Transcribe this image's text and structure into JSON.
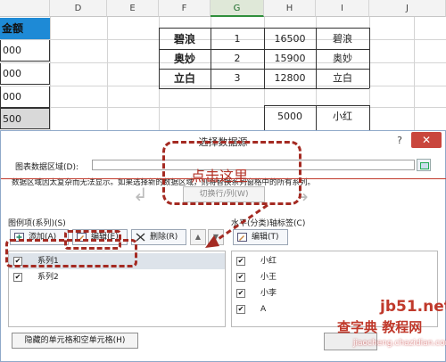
{
  "sheet": {
    "columns": [
      "D",
      "E",
      "F",
      "G",
      "H",
      "I",
      "J"
    ],
    "selected_column": "G",
    "amount_header": "金额",
    "left_values": [
      "000",
      "000",
      "000",
      "500"
    ],
    "table_rows": [
      {
        "name": "碧浪",
        "rank": "1",
        "amount": "16500",
        "person": "碧浪"
      },
      {
        "name": "奥妙",
        "rank": "2",
        "amount": "15900",
        "person": "奥妙"
      },
      {
        "name": "立白",
        "rank": "3",
        "amount": "12800",
        "person": "立白"
      }
    ],
    "extra_row": {
      "amount": "5000",
      "person": "小红"
    }
  },
  "dialog": {
    "title": "选择数据源",
    "help": "?",
    "close": "✕",
    "range_label": "图表数据区域(D):",
    "warning": "数据区域因太复杂而无法显示。如果选择新的数据区域，则将替换系列窗格中的所有系列。",
    "switch_label": "切换行/列(W)",
    "legend_label": "图例项(系列)(S)",
    "legend_buttons": {
      "add": "添加(A)",
      "edit": "编辑(E)",
      "delete": "删除(R)"
    },
    "series": [
      {
        "label": "系列1",
        "checked": true
      },
      {
        "label": "系列2",
        "checked": true
      }
    ],
    "axis_label": "水平(分类)轴标签(C)",
    "axis_edit": "编辑(T)",
    "categories": [
      {
        "label": "小红",
        "checked": true
      },
      {
        "label": "小王",
        "checked": true
      },
      {
        "label": "小李",
        "checked": true
      },
      {
        "label": "A",
        "checked": true
      }
    ],
    "hidden_cells_button": "隐藏的单元格和空单元格(H)"
  },
  "annotation": {
    "callout": "点击这里"
  },
  "watermarks": {
    "site": "jb51.net",
    "brand": "查字典 教程网",
    "subsite": "jiaocheng.chazidian.com"
  },
  "colors": {
    "header_blue": "#1e8ad6",
    "annotation_red": "#a42a22",
    "close_red": "#c9463d",
    "selection_green": "#2f8f3b"
  }
}
